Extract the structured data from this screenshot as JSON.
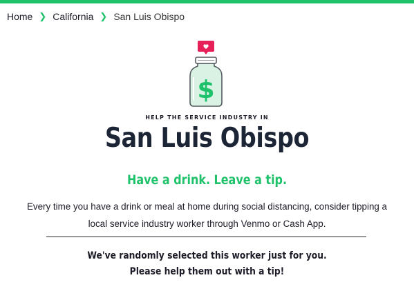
{
  "colors": {
    "accent": "#1ec26a",
    "heart_badge": "#e8205a",
    "title": "#1c2536",
    "text": "#1c1c28"
  },
  "breadcrumb": {
    "items": [
      {
        "label": "Home"
      },
      {
        "label": "California"
      },
      {
        "label": "San Luis Obispo"
      }
    ],
    "separator": ">"
  },
  "hero": {
    "icon": "tip-jar-icon",
    "badge_icon": "heart-icon",
    "jar_symbol": "$",
    "pre_title": "HELP THE SERVICE INDUSTRY IN",
    "city": "San Luis Obispo",
    "tagline": "Have a drink. Leave a tip.",
    "intro_line1": "Every time you have a drink or meal at home during social distancing, consider tipping a",
    "intro_line2": "local service industry worker through Venmo or Cash App."
  },
  "selection": {
    "line1": "We've randomly selected this worker just for you.",
    "line2": "Please help them out with a tip!"
  }
}
